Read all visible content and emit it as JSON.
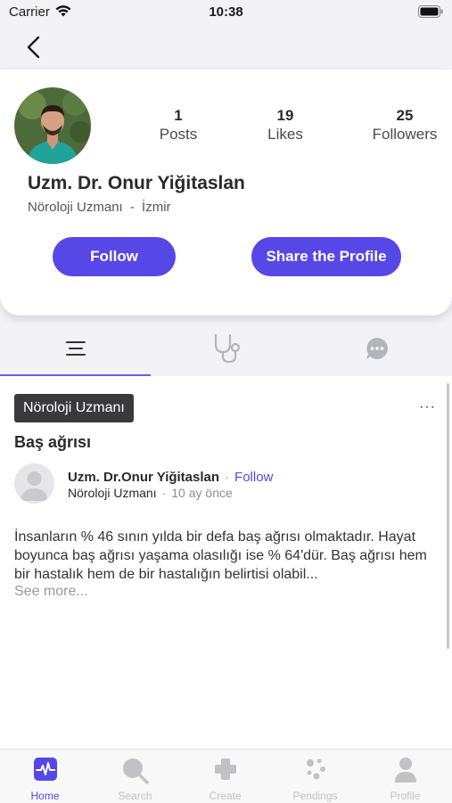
{
  "status_bar": {
    "carrier": "Carrier",
    "time": "10:38"
  },
  "profile": {
    "name": "Uzm. Dr. Onur Yiğitaslan",
    "specialty": "Nöroloji Uzmanı",
    "separator": "-",
    "city": "İzmir",
    "stats": [
      {
        "value": "1",
        "label": "Posts"
      },
      {
        "value": "19",
        "label": "Likes"
      },
      {
        "value": "25",
        "label": "Followers"
      }
    ],
    "follow_label": "Follow",
    "share_label": "Share the Profile"
  },
  "tabs": [
    {
      "icon": "list-icon",
      "active": true
    },
    {
      "icon": "stethoscope-icon",
      "active": false
    },
    {
      "icon": "chat-bubble-icon",
      "active": false
    }
  ],
  "post": {
    "tag": "Nöroloji Uzmanı",
    "menu": "···",
    "title": "Baş ağrısı",
    "author_name": "Uzm. Dr.Onur Yiğitaslan",
    "dot": "·",
    "follow_label": "Follow",
    "author_specialty": "Nöroloji Uzmanı",
    "time_ago": "10 ay önce",
    "body": "İnsanların % 46 sının yılda bir defa baş ağrısı olmaktadır. Hayat boyunca baş ağrısı yaşama olasılığı ise % 64'dür. Baş ağrısı hem bir hastalık hem de bir hastalığın belirtisi olabil...",
    "see_more": "See more..."
  },
  "bottom_nav": [
    {
      "label": "Home",
      "icon": "pulse-icon",
      "active": true
    },
    {
      "label": "Search",
      "icon": "search-icon",
      "active": false
    },
    {
      "label": "Create",
      "icon": "plus-icon",
      "active": false
    },
    {
      "label": "Pendings",
      "icon": "dots-icon",
      "active": false
    },
    {
      "label": "Profile",
      "icon": "person-icon",
      "active": false
    }
  ],
  "colors": {
    "accent": "#5548e6",
    "tag_bg": "#3a3a3c",
    "inactive_icon": "#c2c2c6"
  }
}
